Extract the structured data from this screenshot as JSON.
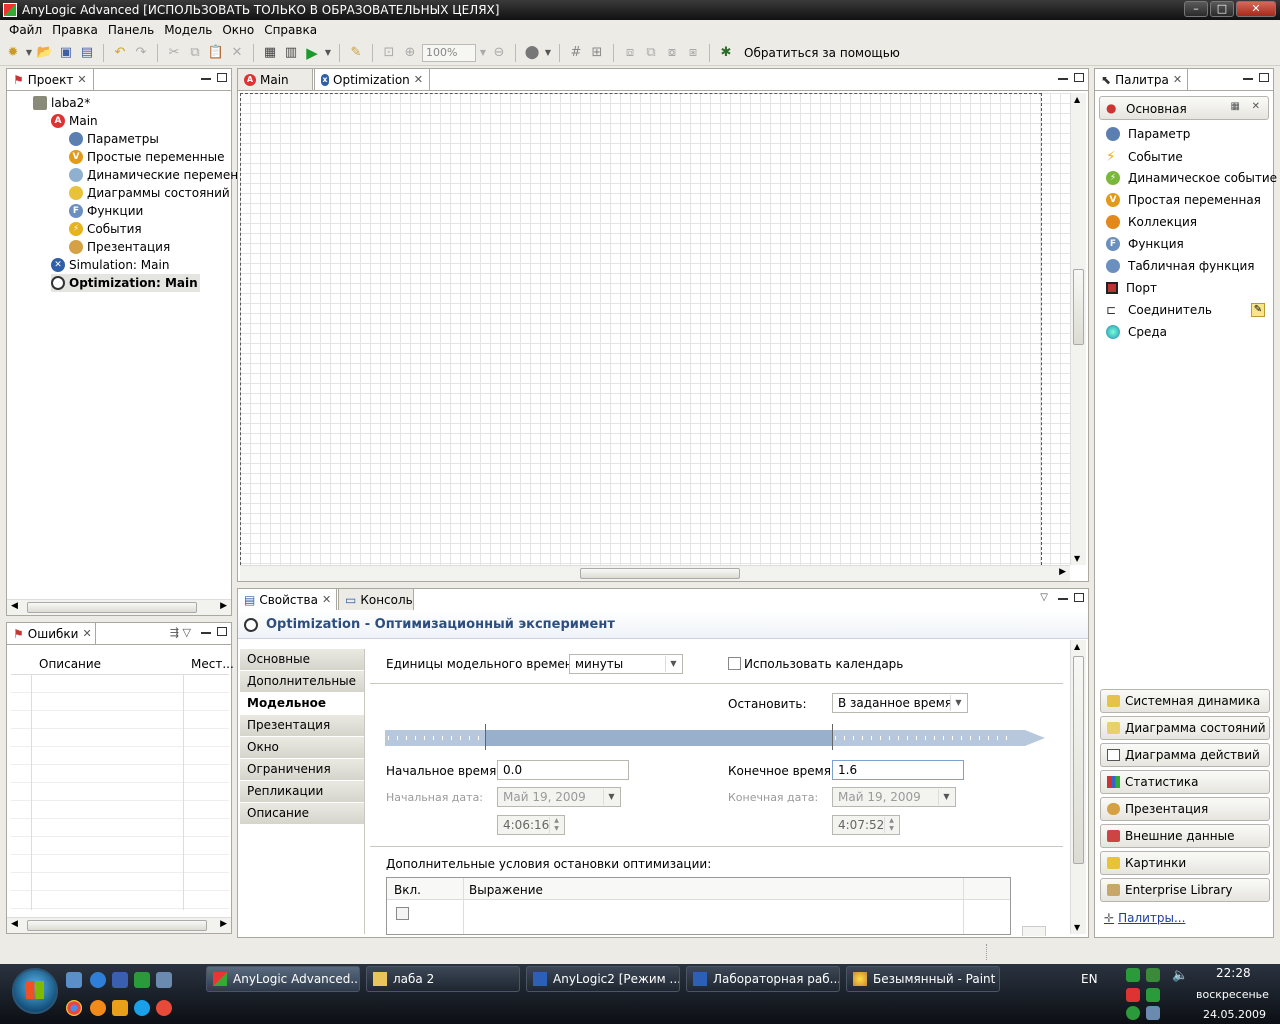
{
  "window": {
    "title": "AnyLogic Advanced [ИСПОЛЬЗОВАТЬ ТОЛЬКО В ОБРАЗОВАТЕЛЬНЫХ ЦЕЛЯХ]"
  },
  "menu": [
    "Файл",
    "Правка",
    "Панель",
    "Модель",
    "Окно",
    "Справка"
  ],
  "toolbar": {
    "zoom": "100%",
    "help_label": "Обратиться за помощью"
  },
  "project_panel": {
    "tab": "Проект",
    "tree": [
      {
        "label": "laba2*",
        "icon": "project-icon"
      },
      {
        "label": "Main",
        "icon": "active-object-icon"
      },
      {
        "label": "Параметры",
        "icon": "parameters-icon"
      },
      {
        "label": "Простые переменные",
        "icon": "variables-icon"
      },
      {
        "label": "Динамические переменн",
        "icon": "dynamic-variables-icon"
      },
      {
        "label": "Диаграммы состояний",
        "icon": "statecharts-icon"
      },
      {
        "label": "Функции",
        "icon": "functions-icon"
      },
      {
        "label": "События",
        "icon": "events-icon"
      },
      {
        "label": "Презентация",
        "icon": "presentation-icon"
      },
      {
        "label": "Simulation: Main",
        "icon": "simulation-icon"
      },
      {
        "label": "Optimization: Main",
        "icon": "optimization-icon"
      }
    ]
  },
  "errors_panel": {
    "tab": "Ошибки",
    "col_description": "Описание",
    "col_location": "Мест..."
  },
  "editor": {
    "tabs": [
      "Main",
      "Optimization"
    ]
  },
  "properties": {
    "tabs": [
      "Свойства",
      "Консоль"
    ],
    "header": "Optimization - Оптимизационный эксперимент",
    "nav": [
      "Основные",
      "Дополнительные",
      "Модельное время",
      "Презентация",
      "Окно",
      "Ограничения",
      "Репликации",
      "Описание"
    ],
    "active_nav": "Модельное время",
    "time_units_label": "Единицы модельного времени:",
    "time_units_value": "минуты",
    "use_calendar_label": "Использовать календарь",
    "stop_label": "Остановить:",
    "stop_value": "В заданное время",
    "start_time_label": "Начальное время:",
    "start_time_value": "0.0",
    "end_time_label": "Конечное время:",
    "end_time_value": "1.6",
    "start_date_label": "Начальная дата:",
    "start_date_value": "Май 19, 2009",
    "end_date_label": "Конечная дата:",
    "end_date_value": "Май 19, 2009",
    "start_clock": "4:06:16",
    "end_clock": "4:07:52",
    "extra_stop_label": "Дополнительные условия остановки оптимизации:",
    "table_col_enabled": "Вкл.",
    "table_col_expression": "Выражение"
  },
  "palette": {
    "tab": "Палитра",
    "section": "Основная",
    "items": [
      "Параметр",
      "Событие",
      "Динамическое событие",
      "Простая переменная",
      "Коллекция",
      "Функция",
      "Табличная функция",
      "Порт",
      "Соединитель",
      "Среда"
    ],
    "groups": [
      "Системная динамика",
      "Диаграмма состояний",
      "Диаграмма действий",
      "Статистика",
      "Презентация",
      "Внешние данные",
      "Картинки",
      "Enterprise Library"
    ],
    "link": "Палитры..."
  },
  "taskbar": {
    "buttons": [
      "AnyLogic Advanced...",
      "лаба 2",
      "AnyLogic2 [Режим ...",
      "Лабораторная раб...",
      "Безымянный - Paint"
    ],
    "lang": "EN",
    "time": "22:28",
    "day": "воскресенье",
    "date": "24.05.2009"
  }
}
